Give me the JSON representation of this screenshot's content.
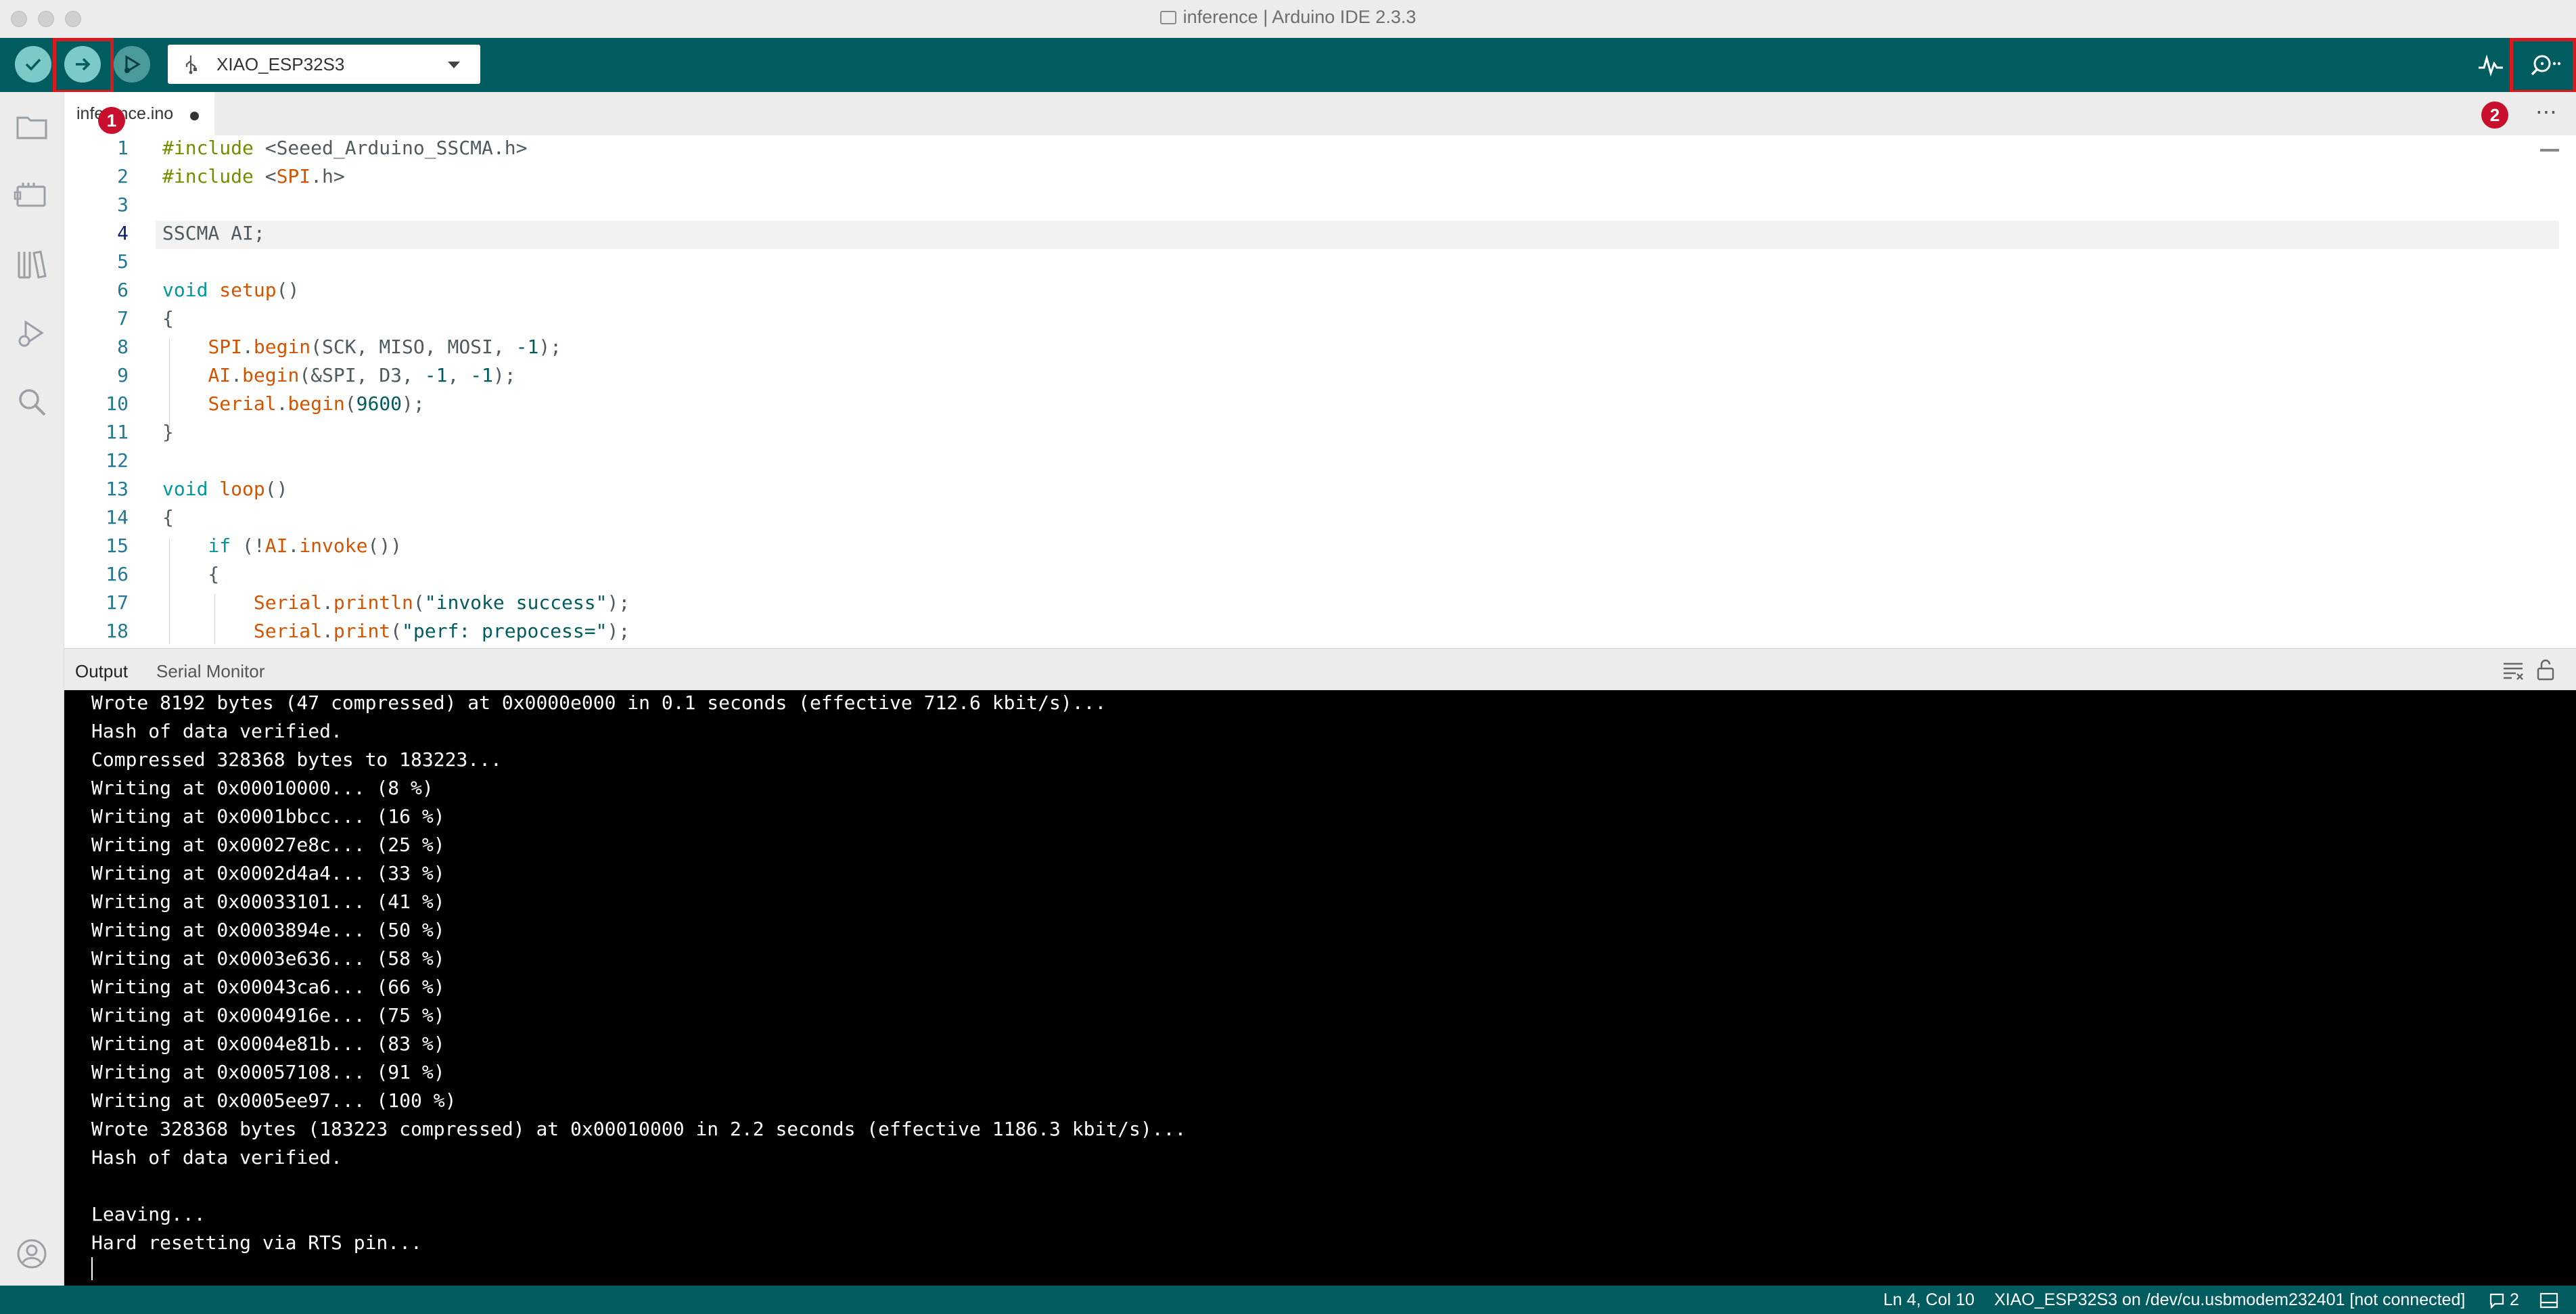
{
  "window": {
    "title": "inference | Arduino IDE 2.3.3"
  },
  "toolbar": {
    "verify": "verify",
    "upload": "upload",
    "debug": "debug",
    "board_name": "XIAO_ESP32S3",
    "badge_upload": "1",
    "badge_monitor": "2",
    "serial_plotter": "serial plotter",
    "serial_monitor": "serial monitor"
  },
  "activity_bar": [
    "sketchbook",
    "boards manager",
    "library manager",
    "debug",
    "search",
    "account"
  ],
  "tab": {
    "label": "inference.ino",
    "more": "⋯"
  },
  "editor": {
    "line_numbers": [
      "1",
      "2",
      "3",
      "4",
      "5",
      "6",
      "7",
      "8",
      "9",
      "10",
      "11",
      "12",
      "13",
      "14",
      "15",
      "16",
      "17",
      "18"
    ],
    "lines": [
      "#include <Seeed_Arduino_SSCMA.h>",
      "#include <SPI.h>",
      "",
      "SSCMA AI;",
      "",
      "void setup()",
      "{",
      "    SPI.begin(SCK, MISO, MOSI, -1);",
      "    AI.begin(&SPI, D3, -1, -1);",
      "    Serial.begin(9600);",
      "}",
      "",
      "void loop()",
      "{",
      "    if (!AI.invoke())",
      "    {",
      "        Serial.println(\"invoke success\");",
      "        Serial.print(\"perf: prepocess=\");"
    ],
    "current_line": "4"
  },
  "panel": {
    "tab_output": "Output",
    "tab_serial_monitor": "Serial Monitor",
    "output_lines": [
      "Wrote 8192 bytes (47 compressed) at 0x0000e000 in 0.1 seconds (effective 712.6 kbit/s)...",
      "Hash of data verified.",
      "Compressed 328368 bytes to 183223...",
      "Writing at 0x00010000... (8 %)",
      "Writing at 0x0001bbcc... (16 %)",
      "Writing at 0x00027e8c... (25 %)",
      "Writing at 0x0002d4a4... (33 %)",
      "Writing at 0x00033101... (41 %)",
      "Writing at 0x0003894e... (50 %)",
      "Writing at 0x0003e636... (58 %)",
      "Writing at 0x00043ca6... (66 %)",
      "Writing at 0x0004916e... (75 %)",
      "Writing at 0x0004e81b... (83 %)",
      "Writing at 0x00057108... (91 %)",
      "Writing at 0x0005ee97... (100 %)",
      "Wrote 328368 bytes (183223 compressed) at 0x00010000 in 2.2 seconds (effective 1186.3 kbit/s)...",
      "Hash of data verified.",
      "",
      "Leaving...",
      "Hard resetting via RTS pin..."
    ]
  },
  "status": {
    "cursor": "Ln 4, Col 10",
    "connection": "XIAO_ESP32S3 on /dev/cu.usbmodem232401 [not connected]",
    "notifications": "2"
  },
  "colors": {
    "teal": "#005c5f",
    "highlight": "#d71920",
    "badge": "#c8102e"
  }
}
